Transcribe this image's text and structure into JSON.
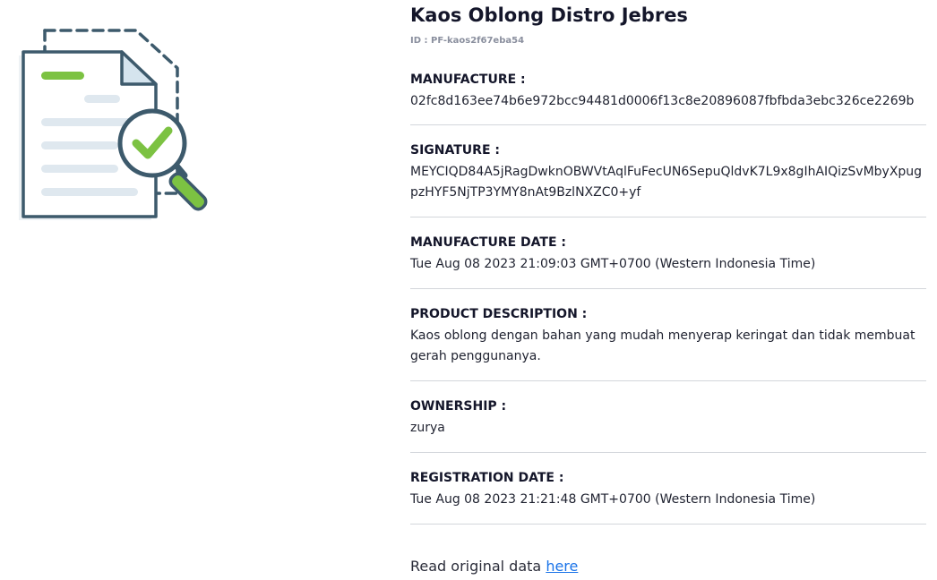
{
  "product": {
    "name": "Kaos Oblong Distro Jebres",
    "id": "ID : PF-kaos2f67eba54"
  },
  "fields": {
    "manufacture": {
      "label": "MANUFACTURE :",
      "value": "02fc8d163ee74b6e972bcc94481d0006f13c8e20896087fbfbda3ebc326ce2269b"
    },
    "signature": {
      "label": "SIGNATURE :",
      "value": "MEYCIQD84A5jRagDwknOBWVtAqlFuFecUN6SepuQldvK7L9x8gIhAIQizSvMbyXpugpzHYF5NjTP3YMY8nAt9BzlNXZC0+yf"
    },
    "manufacture_date": {
      "label": "MANUFACTURE DATE :",
      "value": "Tue Aug 08 2023 21:09:03 GMT+0700 (Western Indonesia Time)"
    },
    "product_description": {
      "label": "PRODUCT DESCRIPTION :",
      "value": "Kaos oblong dengan bahan yang mudah menyerap keringat dan tidak membuat gerah penggunanya."
    },
    "ownership": {
      "label": "OWNERSHIP :",
      "value": "zurya"
    },
    "registration_date": {
      "label": "REGISTRATION DATE :",
      "value": "Tue Aug 08 2023 21:21:48 GMT+0700 (Western Indonesia Time)"
    }
  },
  "footer": {
    "read_original_text": "Read original data",
    "link_text": "here"
  },
  "illustration": {
    "icon": "document-verified-magnifier-icon",
    "colors": {
      "outline": "#3d5a6c",
      "check": "#7cc242",
      "lines": "#dfe8ef",
      "corner": "#d5e4ee"
    }
  },
  "theme": {
    "link_color": "#1a73e8",
    "divider_color": "#d3d6db"
  }
}
